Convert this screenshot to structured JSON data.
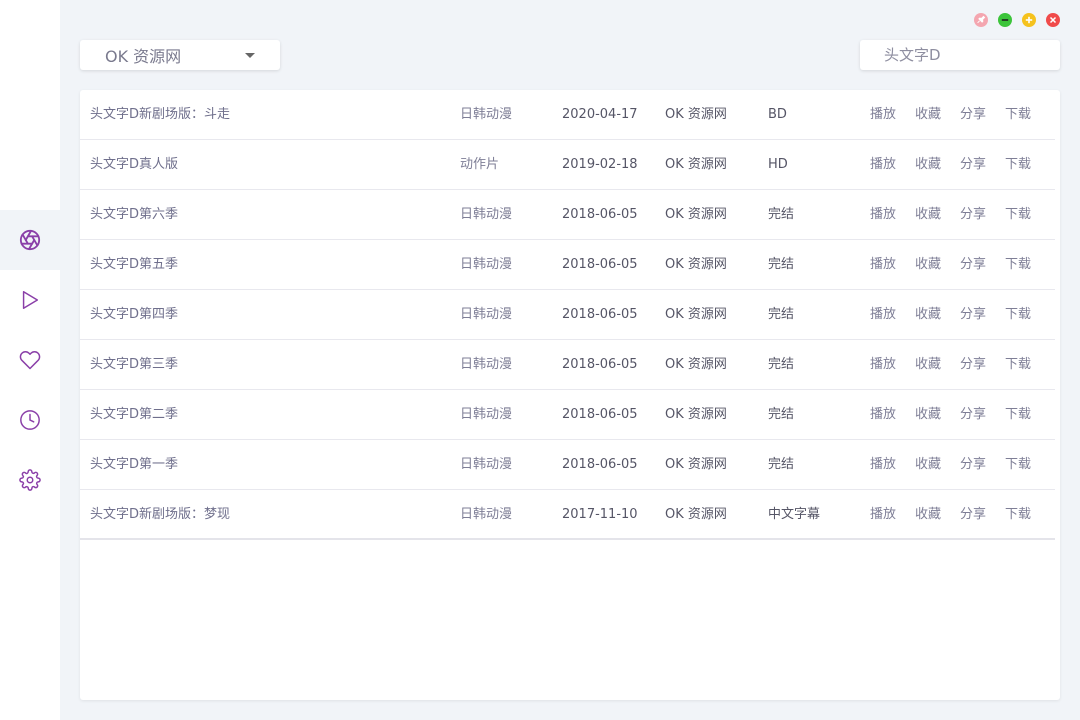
{
  "colors": {
    "accent": "#8a3fa8",
    "background": "#f1f4f8",
    "pin": "#f4a6b0",
    "minimize": "#3cc43a",
    "maximize": "#f5c21e",
    "close": "#f04a4a"
  },
  "sidebar": {
    "items": [
      {
        "icon": "aperture-icon",
        "active": true
      },
      {
        "icon": "play-icon",
        "active": false
      },
      {
        "icon": "heart-icon",
        "active": false
      },
      {
        "icon": "clock-icon",
        "active": false
      },
      {
        "icon": "settings-icon",
        "active": false
      }
    ]
  },
  "window_controls": [
    "pin-icon",
    "minimize-icon",
    "maximize-icon",
    "close-icon"
  ],
  "source_select": {
    "value": "OK 资源网"
  },
  "search": {
    "value": "",
    "placeholder": "头文字D"
  },
  "actions": {
    "play": "播放",
    "favorite": "收藏",
    "share": "分享",
    "download": "下载"
  },
  "results": [
    {
      "title": "头文字D新剧场版：斗走",
      "category": "日韩动漫",
      "date": "2020-04-17",
      "site": "OK 资源网",
      "quality": "BD"
    },
    {
      "title": "头文字D真人版",
      "category": "动作片",
      "date": "2019-02-18",
      "site": "OK 资源网",
      "quality": "HD"
    },
    {
      "title": "头文字D第六季",
      "category": "日韩动漫",
      "date": "2018-06-05",
      "site": "OK 资源网",
      "quality": "完结"
    },
    {
      "title": "头文字D第五季",
      "category": "日韩动漫",
      "date": "2018-06-05",
      "site": "OK 资源网",
      "quality": "完结"
    },
    {
      "title": "头文字D第四季",
      "category": "日韩动漫",
      "date": "2018-06-05",
      "site": "OK 资源网",
      "quality": "完结"
    },
    {
      "title": "头文字D第三季",
      "category": "日韩动漫",
      "date": "2018-06-05",
      "site": "OK 资源网",
      "quality": "完结"
    },
    {
      "title": "头文字D第二季",
      "category": "日韩动漫",
      "date": "2018-06-05",
      "site": "OK 资源网",
      "quality": "完结"
    },
    {
      "title": "头文字D第一季",
      "category": "日韩动漫",
      "date": "2018-06-05",
      "site": "OK 资源网",
      "quality": "完结"
    },
    {
      "title": "头文字D新剧场版：梦现",
      "category": "日韩动漫",
      "date": "2017-11-10",
      "site": "OK 资源网",
      "quality": "中文字幕"
    }
  ]
}
